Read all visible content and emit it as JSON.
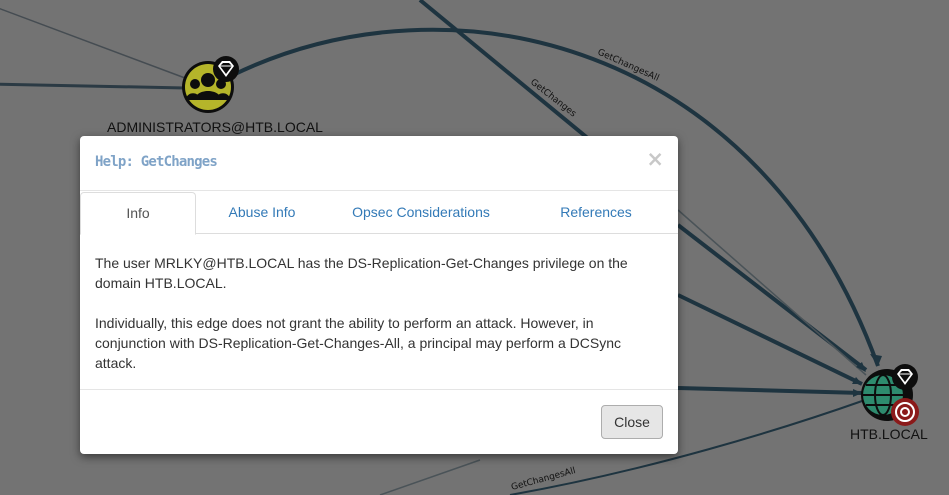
{
  "graph": {
    "nodes": [
      {
        "label": "ADMINISTRATORS@HTB.LOCAL",
        "type": "group",
        "icon": "users-icon",
        "badge": "gem-icon"
      },
      {
        "label": "HTB.LOCAL",
        "type": "domain",
        "icon": "globe-icon",
        "badges": [
          "gem-icon",
          "target-icon"
        ]
      }
    ],
    "edge_labels": [
      "GetChangesAll",
      "GetChanges",
      "GetChangesAll"
    ]
  },
  "modal": {
    "title": "Help: GetChanges",
    "close_symbol": "×",
    "tabs": [
      {
        "label": "Info",
        "active": true
      },
      {
        "label": "Abuse Info",
        "active": false
      },
      {
        "label": "Opsec Considerations",
        "active": false
      },
      {
        "label": "References",
        "active": false
      }
    ],
    "body": {
      "paragraph_1": "The user MRLKY@HTB.LOCAL has the DS-Replication-Get-Changes privilege on the domain HTB.LOCAL.",
      "paragraph_2": "Individually, this edge does not grant the ability to perform an attack. However, in conjunction with DS-Replication-Get-Changes-All, a principal may perform a DCSync attack."
    },
    "footer": {
      "close_label": "Close"
    }
  },
  "colors": {
    "backdrop": "#737373",
    "edge": "#1e3440",
    "group_node": "#b5b52a",
    "domain_node": "#2e8b6e",
    "target_badge": "#8b1a1a",
    "title_color": "#7fa3c7",
    "link_color": "#337ab7"
  }
}
